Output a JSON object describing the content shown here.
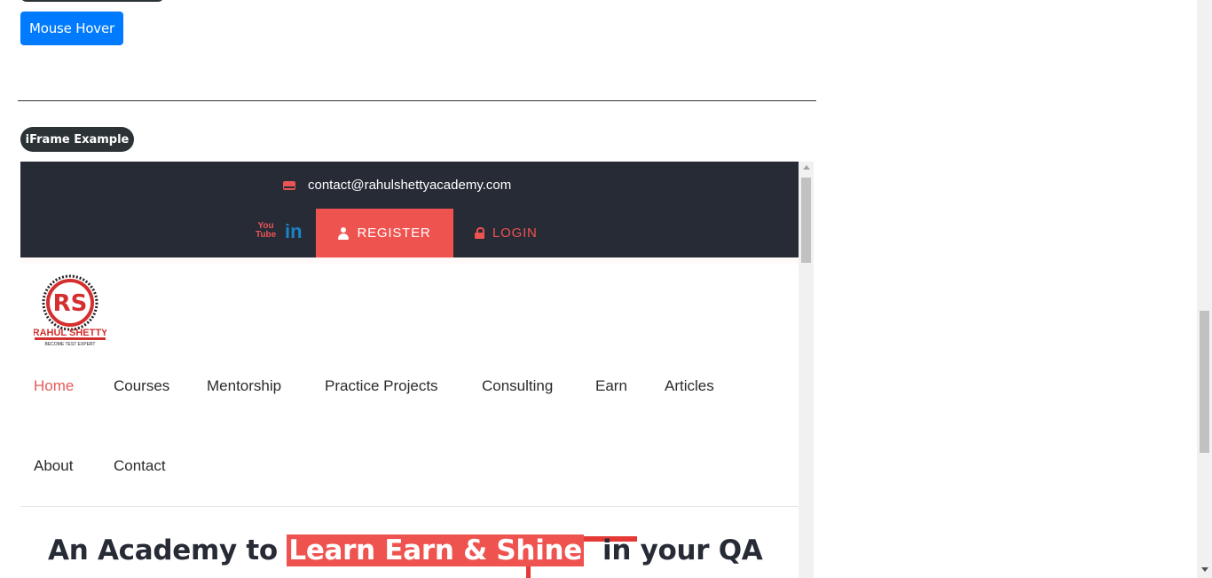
{
  "page": {
    "mouse_hover_label": "Mouse Hover",
    "iframe_badge_label": "iFrame Example"
  },
  "iframe": {
    "contact_email": "contact@rahulshettyacademy.com",
    "register_label": "REGISTER",
    "login_label": "LOGIN",
    "youtube_text": "You Tube",
    "linkedin_text": "in",
    "logo": {
      "title": "RAHUL SHETTY",
      "tagline": "BECOME TEST EXPERT",
      "monogram": "RS"
    },
    "nav": [
      {
        "label": "Home",
        "active": true
      },
      {
        "label": "Courses"
      },
      {
        "label": "Mentorship"
      },
      {
        "label": "Practice Projects"
      },
      {
        "label": "Consulting"
      },
      {
        "label": "Earn"
      },
      {
        "label": "Articles"
      },
      {
        "label": "About"
      },
      {
        "label": "Contact"
      }
    ],
    "hero": {
      "pre": "An Academy to ",
      "highlight": "Learn Earn & Shine",
      "post": "  in your QA"
    }
  },
  "colors": {
    "accent": "#ef5350",
    "topbar": "#262b36",
    "button": "#007bff"
  }
}
